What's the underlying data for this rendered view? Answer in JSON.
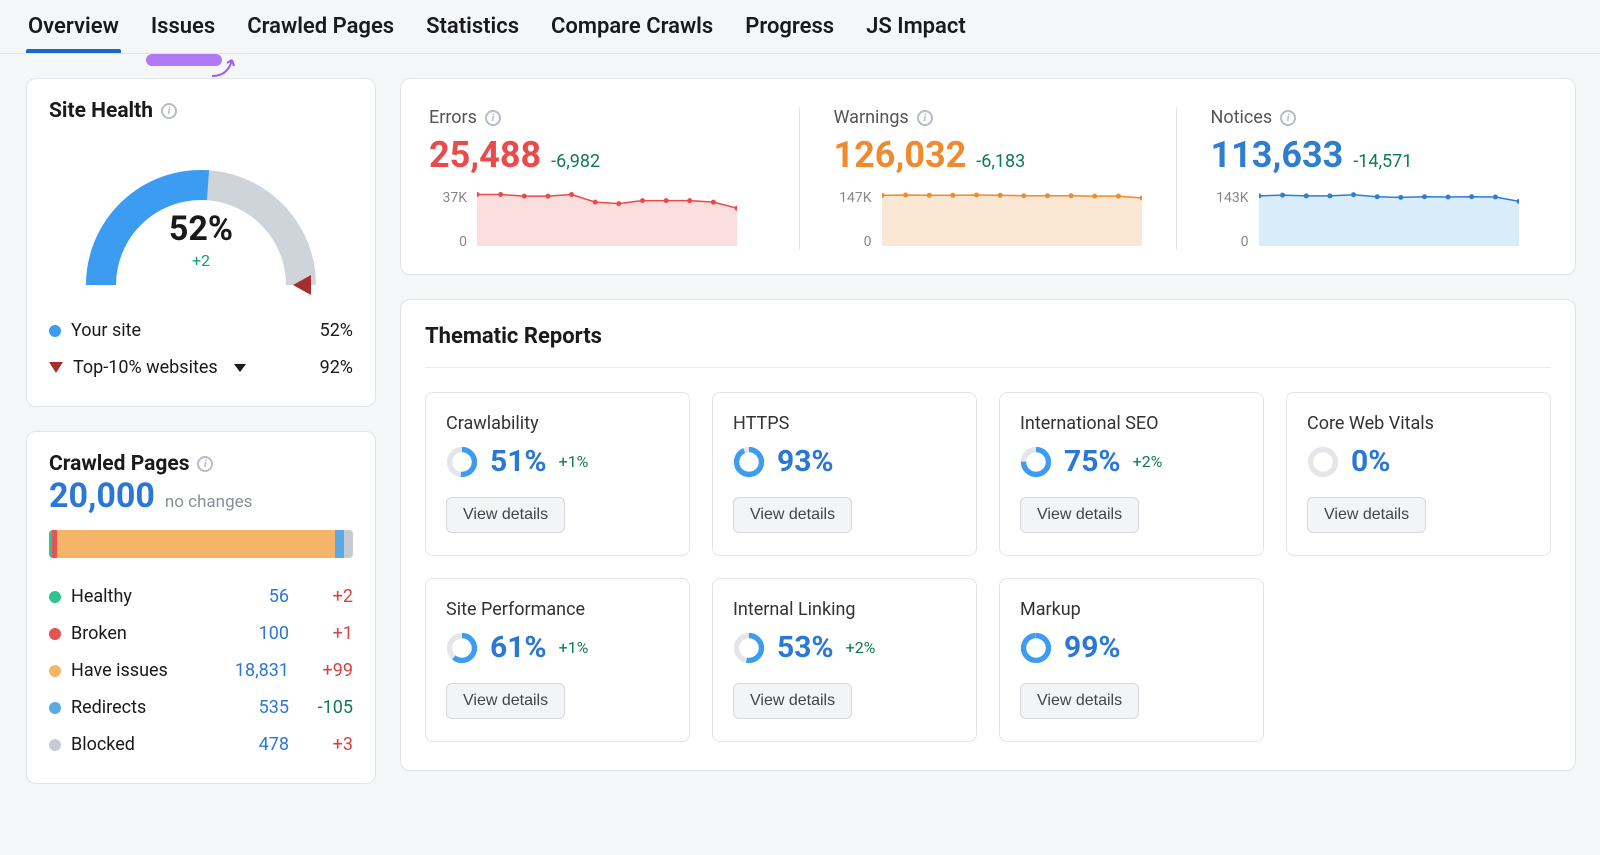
{
  "tabs": {
    "overview": "Overview",
    "issues": "Issues",
    "crawled": "Crawled Pages",
    "statistics": "Statistics",
    "compare": "Compare Crawls",
    "progress": "Progress",
    "jsimpact": "JS Impact"
  },
  "site_health": {
    "title": "Site Health",
    "percent": "52%",
    "delta": "+2",
    "legend_your_site": "Your site",
    "legend_your_site_val": "52%",
    "legend_top10": "Top-10% websites",
    "legend_top10_val": "92%"
  },
  "crawled_pages": {
    "title": "Crawled Pages",
    "total": "20,000",
    "sub": "no changes",
    "rows": [
      {
        "label": "Healthy",
        "count": "56",
        "delta": "+2",
        "color": "dot-green",
        "deltaClass": "delta-pos"
      },
      {
        "label": "Broken",
        "count": "100",
        "delta": "+1",
        "color": "dot-red",
        "deltaClass": "delta-pos"
      },
      {
        "label": "Have issues",
        "count": "18,831",
        "delta": "+99",
        "color": "dot-orange",
        "deltaClass": "delta-pos"
      },
      {
        "label": "Redirects",
        "count": "535",
        "delta": "-105",
        "color": "dot-lblue",
        "deltaClass": "delta-neg"
      },
      {
        "label": "Blocked",
        "count": "478",
        "delta": "+3",
        "color": "dot-grey",
        "deltaClass": "delta-pos"
      }
    ]
  },
  "stats": {
    "errors": {
      "label": "Errors",
      "value": "25,488",
      "delta": "-6,982",
      "ymax": "37K",
      "ymin": "0",
      "color": "#ea4a4a",
      "fill": "#fbdede"
    },
    "warnings": {
      "label": "Warnings",
      "value": "126,032",
      "delta": "-6,183",
      "ymax": "147K",
      "ymin": "0",
      "color": "#ef8a2d",
      "fill": "#fbe8d4"
    },
    "notices": {
      "label": "Notices",
      "value": "113,633",
      "delta": "-14,571",
      "ymax": "143K",
      "ymin": "0",
      "color": "#2f7dd1",
      "fill": "#d9ecfa"
    }
  },
  "thematic": {
    "title": "Thematic Reports",
    "view_details": "View details",
    "reports": [
      {
        "name": "Crawlability",
        "pct": "51%",
        "delta": "+1%",
        "fill": 0.51
      },
      {
        "name": "HTTPS",
        "pct": "93%",
        "delta": "",
        "fill": 0.93
      },
      {
        "name": "International SEO",
        "pct": "75%",
        "delta": "+2%",
        "fill": 0.75
      },
      {
        "name": "Core Web Vitals",
        "pct": "0%",
        "delta": "",
        "fill": 0.0
      },
      {
        "name": "Site Performance",
        "pct": "61%",
        "delta": "+1%",
        "fill": 0.61
      },
      {
        "name": "Internal Linking",
        "pct": "53%",
        "delta": "+2%",
        "fill": 0.53
      },
      {
        "name": "Markup",
        "pct": "99%",
        "delta": "",
        "fill": 0.99
      }
    ]
  },
  "chart_data": {
    "type": "line",
    "note": "Three sparkline area charts; y-values estimated from pixel geometry relative to displayed axis tick (ymax) and 0. x-axis is categorical crawl index 1..12 (no labels shown).",
    "series": [
      {
        "name": "Errors",
        "ymax": 37000,
        "color": "#ea4a4a",
        "values": [
          34000,
          34000,
          33000,
          33000,
          34000,
          29000,
          28000,
          30000,
          30000,
          30000,
          29000,
          25000
        ]
      },
      {
        "name": "Warnings",
        "ymax": 147000,
        "color": "#ef8a2d",
        "values": [
          133000,
          134000,
          133000,
          133000,
          134000,
          133000,
          132000,
          132000,
          132000,
          131000,
          131000,
          126000
        ]
      },
      {
        "name": "Notices",
        "ymax": 143000,
        "color": "#2f7dd1",
        "values": [
          128000,
          130000,
          128000,
          128000,
          131000,
          126000,
          124000,
          126000,
          125000,
          126000,
          125000,
          114000
        ]
      }
    ]
  }
}
